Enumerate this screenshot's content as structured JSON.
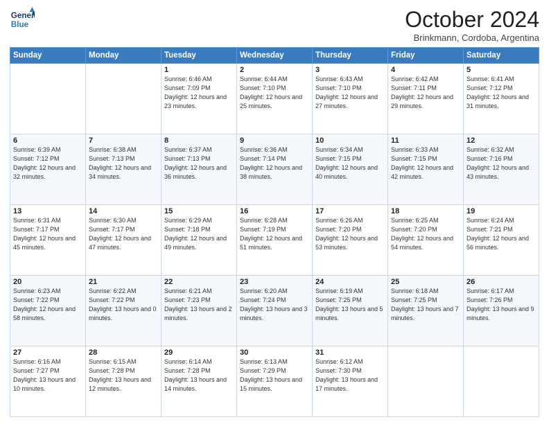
{
  "header": {
    "logo_line1": "General",
    "logo_line2": "Blue",
    "month": "October 2024",
    "location": "Brinkmann, Cordoba, Argentina"
  },
  "days_of_week": [
    "Sunday",
    "Monday",
    "Tuesday",
    "Wednesday",
    "Thursday",
    "Friday",
    "Saturday"
  ],
  "weeks": [
    [
      {
        "day": "",
        "info": ""
      },
      {
        "day": "",
        "info": ""
      },
      {
        "day": "1",
        "info": "Sunrise: 6:46 AM\nSunset: 7:09 PM\nDaylight: 12 hours and 23 minutes."
      },
      {
        "day": "2",
        "info": "Sunrise: 6:44 AM\nSunset: 7:10 PM\nDaylight: 12 hours and 25 minutes."
      },
      {
        "day": "3",
        "info": "Sunrise: 6:43 AM\nSunset: 7:10 PM\nDaylight: 12 hours and 27 minutes."
      },
      {
        "day": "4",
        "info": "Sunrise: 6:42 AM\nSunset: 7:11 PM\nDaylight: 12 hours and 29 minutes."
      },
      {
        "day": "5",
        "info": "Sunrise: 6:41 AM\nSunset: 7:12 PM\nDaylight: 12 hours and 31 minutes."
      }
    ],
    [
      {
        "day": "6",
        "info": "Sunrise: 6:39 AM\nSunset: 7:12 PM\nDaylight: 12 hours and 32 minutes."
      },
      {
        "day": "7",
        "info": "Sunrise: 6:38 AM\nSunset: 7:13 PM\nDaylight: 12 hours and 34 minutes."
      },
      {
        "day": "8",
        "info": "Sunrise: 6:37 AM\nSunset: 7:13 PM\nDaylight: 12 hours and 36 minutes."
      },
      {
        "day": "9",
        "info": "Sunrise: 6:36 AM\nSunset: 7:14 PM\nDaylight: 12 hours and 38 minutes."
      },
      {
        "day": "10",
        "info": "Sunrise: 6:34 AM\nSunset: 7:15 PM\nDaylight: 12 hours and 40 minutes."
      },
      {
        "day": "11",
        "info": "Sunrise: 6:33 AM\nSunset: 7:15 PM\nDaylight: 12 hours and 42 minutes."
      },
      {
        "day": "12",
        "info": "Sunrise: 6:32 AM\nSunset: 7:16 PM\nDaylight: 12 hours and 43 minutes."
      }
    ],
    [
      {
        "day": "13",
        "info": "Sunrise: 6:31 AM\nSunset: 7:17 PM\nDaylight: 12 hours and 45 minutes."
      },
      {
        "day": "14",
        "info": "Sunrise: 6:30 AM\nSunset: 7:17 PM\nDaylight: 12 hours and 47 minutes."
      },
      {
        "day": "15",
        "info": "Sunrise: 6:29 AM\nSunset: 7:18 PM\nDaylight: 12 hours and 49 minutes."
      },
      {
        "day": "16",
        "info": "Sunrise: 6:28 AM\nSunset: 7:19 PM\nDaylight: 12 hours and 51 minutes."
      },
      {
        "day": "17",
        "info": "Sunrise: 6:26 AM\nSunset: 7:20 PM\nDaylight: 12 hours and 53 minutes."
      },
      {
        "day": "18",
        "info": "Sunrise: 6:25 AM\nSunset: 7:20 PM\nDaylight: 12 hours and 54 minutes."
      },
      {
        "day": "19",
        "info": "Sunrise: 6:24 AM\nSunset: 7:21 PM\nDaylight: 12 hours and 56 minutes."
      }
    ],
    [
      {
        "day": "20",
        "info": "Sunrise: 6:23 AM\nSunset: 7:22 PM\nDaylight: 12 hours and 58 minutes."
      },
      {
        "day": "21",
        "info": "Sunrise: 6:22 AM\nSunset: 7:22 PM\nDaylight: 13 hours and 0 minutes."
      },
      {
        "day": "22",
        "info": "Sunrise: 6:21 AM\nSunset: 7:23 PM\nDaylight: 13 hours and 2 minutes."
      },
      {
        "day": "23",
        "info": "Sunrise: 6:20 AM\nSunset: 7:24 PM\nDaylight: 13 hours and 3 minutes."
      },
      {
        "day": "24",
        "info": "Sunrise: 6:19 AM\nSunset: 7:25 PM\nDaylight: 13 hours and 5 minutes."
      },
      {
        "day": "25",
        "info": "Sunrise: 6:18 AM\nSunset: 7:25 PM\nDaylight: 13 hours and 7 minutes."
      },
      {
        "day": "26",
        "info": "Sunrise: 6:17 AM\nSunset: 7:26 PM\nDaylight: 13 hours and 9 minutes."
      }
    ],
    [
      {
        "day": "27",
        "info": "Sunrise: 6:16 AM\nSunset: 7:27 PM\nDaylight: 13 hours and 10 minutes."
      },
      {
        "day": "28",
        "info": "Sunrise: 6:15 AM\nSunset: 7:28 PM\nDaylight: 13 hours and 12 minutes."
      },
      {
        "day": "29",
        "info": "Sunrise: 6:14 AM\nSunset: 7:28 PM\nDaylight: 13 hours and 14 minutes."
      },
      {
        "day": "30",
        "info": "Sunrise: 6:13 AM\nSunset: 7:29 PM\nDaylight: 13 hours and 15 minutes."
      },
      {
        "day": "31",
        "info": "Sunrise: 6:12 AM\nSunset: 7:30 PM\nDaylight: 13 hours and 17 minutes."
      },
      {
        "day": "",
        "info": ""
      },
      {
        "day": "",
        "info": ""
      }
    ]
  ]
}
